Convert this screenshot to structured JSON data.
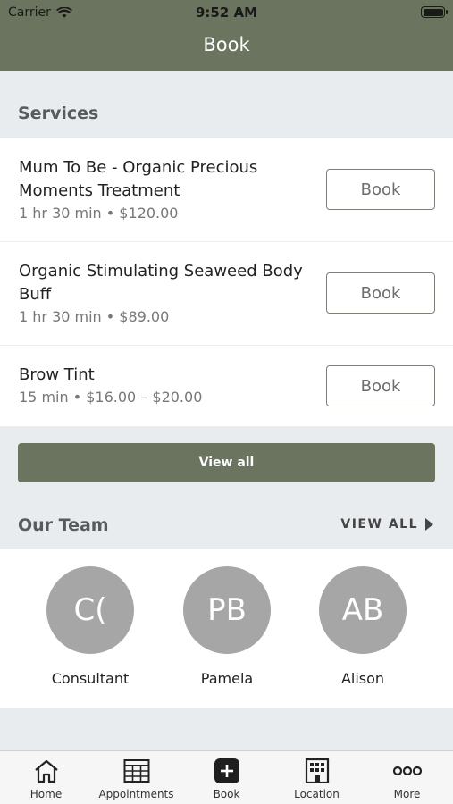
{
  "status": {
    "carrier": "Carrier",
    "time": "9:52 AM"
  },
  "header": {
    "title": "Book"
  },
  "services": {
    "heading": "Services",
    "items": [
      {
        "name": "Mum To Be - Organic Precious Moments Treatment",
        "meta": "1 hr 30 min • $120.00",
        "action": "Book"
      },
      {
        "name": "Organic Stimulating Seaweed Body Buff",
        "meta": "1 hr 30 min • $89.00",
        "action": "Book"
      },
      {
        "name": "Brow Tint",
        "meta": "15 min • $16.00 – $20.00",
        "action": "Book"
      }
    ],
    "view_all": "View all"
  },
  "team": {
    "heading": "Our Team",
    "view_all": "VIEW ALL",
    "members": [
      {
        "initials": "C(",
        "name": "Consultant"
      },
      {
        "initials": "PB",
        "name": "Pamela"
      },
      {
        "initials": "AB",
        "name": "Alison"
      }
    ]
  },
  "tabbar": {
    "tabs": [
      {
        "label": "Home",
        "icon": "home-icon"
      },
      {
        "label": "Appointments",
        "icon": "calendar-icon"
      },
      {
        "label": "Book",
        "icon": "plus-icon"
      },
      {
        "label": "Location",
        "icon": "building-icon"
      },
      {
        "label": "More",
        "icon": "more-icon"
      }
    ]
  },
  "colors": {
    "brand": "#6b745e",
    "avatar": "#a6a6a6",
    "background": "#e9ecef"
  }
}
